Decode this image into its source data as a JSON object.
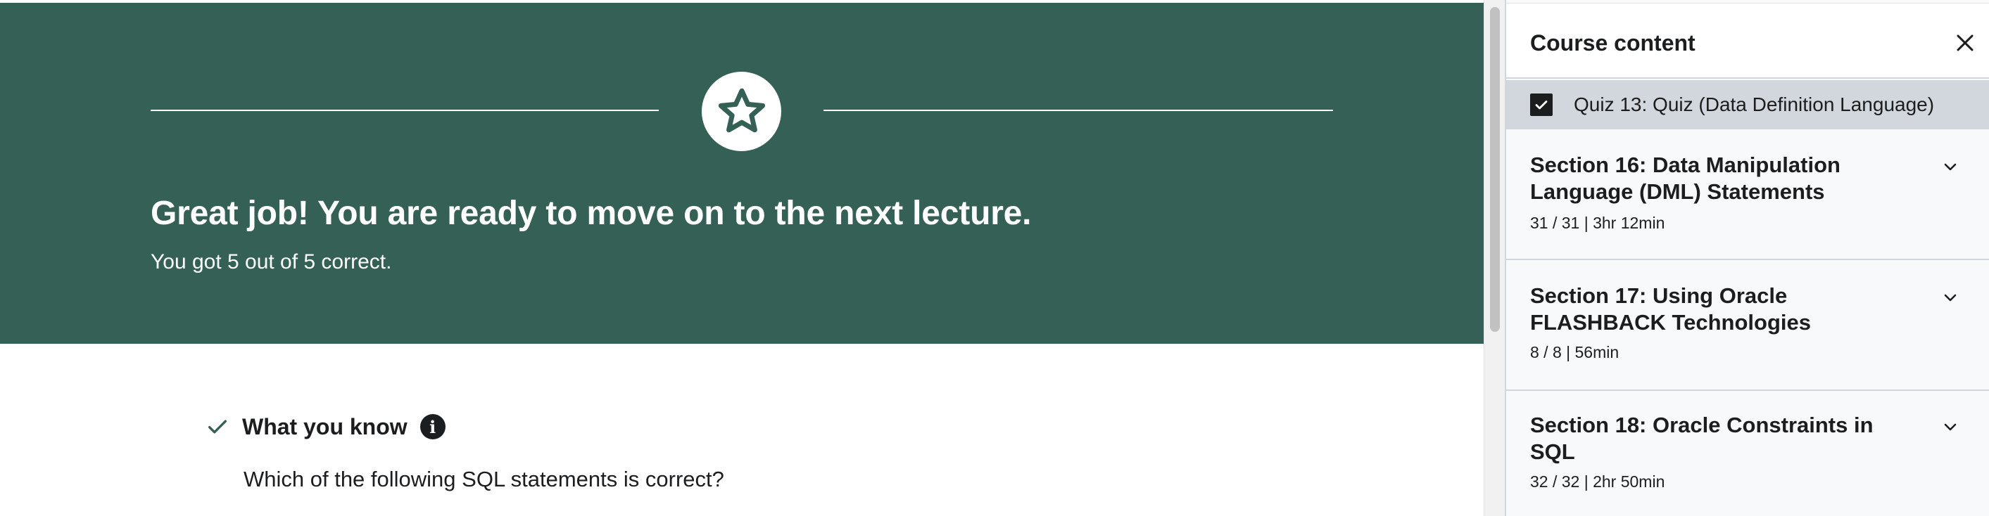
{
  "hero": {
    "title": "Great job! You are ready to move on to the next lecture.",
    "subtitle": "You got 5 out of 5 correct.",
    "badge_icon": "star-icon",
    "background_color": "#346055"
  },
  "knowledge": {
    "heading": "What you know",
    "info_icon_glyph": "i",
    "question": "Which of the following SQL statements is correct?"
  },
  "sidebar": {
    "title": "Course content",
    "close_icon": "close-icon",
    "current_item": {
      "label": "Quiz 13: Quiz (Data Definition Language)",
      "checked": true
    },
    "sections": [
      {
        "title": "Section 16: Data Manipulation Language (DML) Statements",
        "meta": "31 / 31 | 3hr 12min"
      },
      {
        "title": "Section 17: Using Oracle FLASHBACK Technologies",
        "meta": "8 / 8 | 56min"
      },
      {
        "title": "Section 18: Oracle Constraints in SQL",
        "meta": "32 / 32 | 2hr 50min"
      }
    ]
  }
}
